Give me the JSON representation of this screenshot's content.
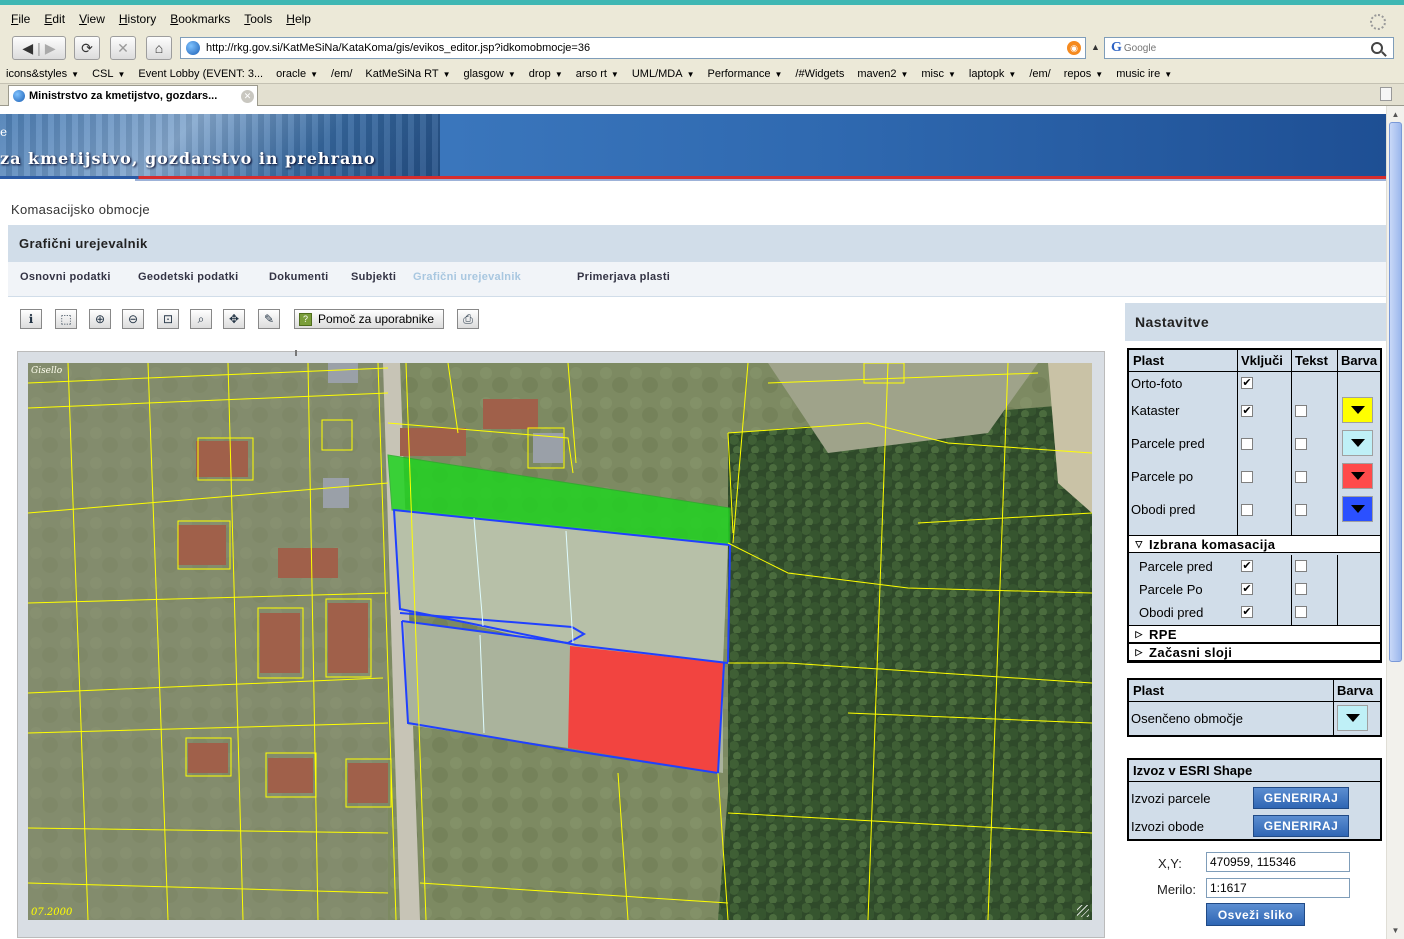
{
  "browser": {
    "menu": [
      "File",
      "Edit",
      "View",
      "History",
      "Bookmarks",
      "Tools",
      "Help"
    ],
    "url": "http://rkg.gov.si/KatMeSiNa/KataKoma/gis/evikos_editor.jsp?idkomobmocje=36",
    "search_placeholder": "Google",
    "bookmarks": [
      {
        "label": "icons&styles",
        "menu": true
      },
      {
        "label": "CSL",
        "menu": true
      },
      {
        "label": "Event Lobby (EVENT: 3...",
        "menu": false
      },
      {
        "label": "oracle",
        "menu": true
      },
      {
        "label": "/em/",
        "menu": false
      },
      {
        "label": "KatMeSiNa RT",
        "menu": true
      },
      {
        "label": "glasgow",
        "menu": true
      },
      {
        "label": "drop",
        "menu": true
      },
      {
        "label": "arso rt",
        "menu": true
      },
      {
        "label": "UML/MDA",
        "menu": true
      },
      {
        "label": "Performance",
        "menu": true
      },
      {
        "label": "/#Widgets",
        "menu": false
      },
      {
        "label": "maven2",
        "menu": true
      },
      {
        "label": "misc",
        "menu": true
      },
      {
        "label": "laptopk",
        "menu": true
      },
      {
        "label": "/em/",
        "menu": false
      },
      {
        "label": "repos",
        "menu": true
      },
      {
        "label": "music ire",
        "menu": true
      }
    ],
    "tab_title": "Ministrstvo za kmetijstvo, gozdars..."
  },
  "header": {
    "banner_line1": "e",
    "banner_line2": "za kmetijstvo, gozdarstvo in prehrano"
  },
  "page": {
    "breadcrumb": "Komasacijsko obmocje",
    "title": "Grafični urejevalnik",
    "nav": [
      {
        "label": "Osnovni podatki",
        "active": false
      },
      {
        "label": "Geodetski podatki",
        "active": false
      },
      {
        "label": "Dokumenti",
        "active": false
      },
      {
        "label": "Subjekti",
        "active": false
      },
      {
        "label": "Grafični urejevalnik",
        "active": true
      },
      {
        "label": "Primerjava plasti",
        "active": false
      }
    ],
    "help_button": "Pomoč za uporabnike"
  },
  "map": {
    "watermark": "Gisello",
    "date": "07.2000"
  },
  "settings": {
    "title": "Nastavitve",
    "layer_headers": {
      "layer": "Plast",
      "on": "Vključi",
      "text": "Tekst",
      "color": "Barva"
    },
    "layers": [
      {
        "name": "Orto-foto",
        "on": true,
        "text": null,
        "color": null
      },
      {
        "name": "Kataster",
        "on": true,
        "text": false,
        "color": "#ffff00"
      },
      {
        "name": "Parcele pred",
        "on": false,
        "text": false,
        "color": "#bff0f7"
      },
      {
        "name": "Parcele po",
        "on": false,
        "text": false,
        "color": "#ff4a4a"
      },
      {
        "name": "Obodi pred",
        "on": false,
        "text": false,
        "color": "#2b50ff"
      }
    ],
    "section_selected": "Izbrana komasacija",
    "selected_layers": [
      {
        "name": "Parcele pred",
        "on": true,
        "text": false
      },
      {
        "name": "Parcele Po",
        "on": true,
        "text": false
      },
      {
        "name": "Obodi pred",
        "on": true,
        "text": false
      }
    ],
    "section_rpe": "RPE",
    "section_temp": "Začasni sloji",
    "shade": {
      "layer_header": "Plast",
      "color_header": "Barva",
      "label": "Osenčeno območje",
      "color": "#bff0f7"
    },
    "export": {
      "title": "Izvoz v ESRI Shape",
      "rows": [
        {
          "label": "Izvozi parcele",
          "button": "GENERIRAJ"
        },
        {
          "label": "Izvozi obode",
          "button": "GENERIRAJ"
        }
      ]
    },
    "coords": {
      "label": "X,Y:",
      "value": "470959, 115346"
    },
    "scale": {
      "label": "Merilo:",
      "value": "1:1617"
    },
    "refresh_button": "Osveži sliko"
  }
}
